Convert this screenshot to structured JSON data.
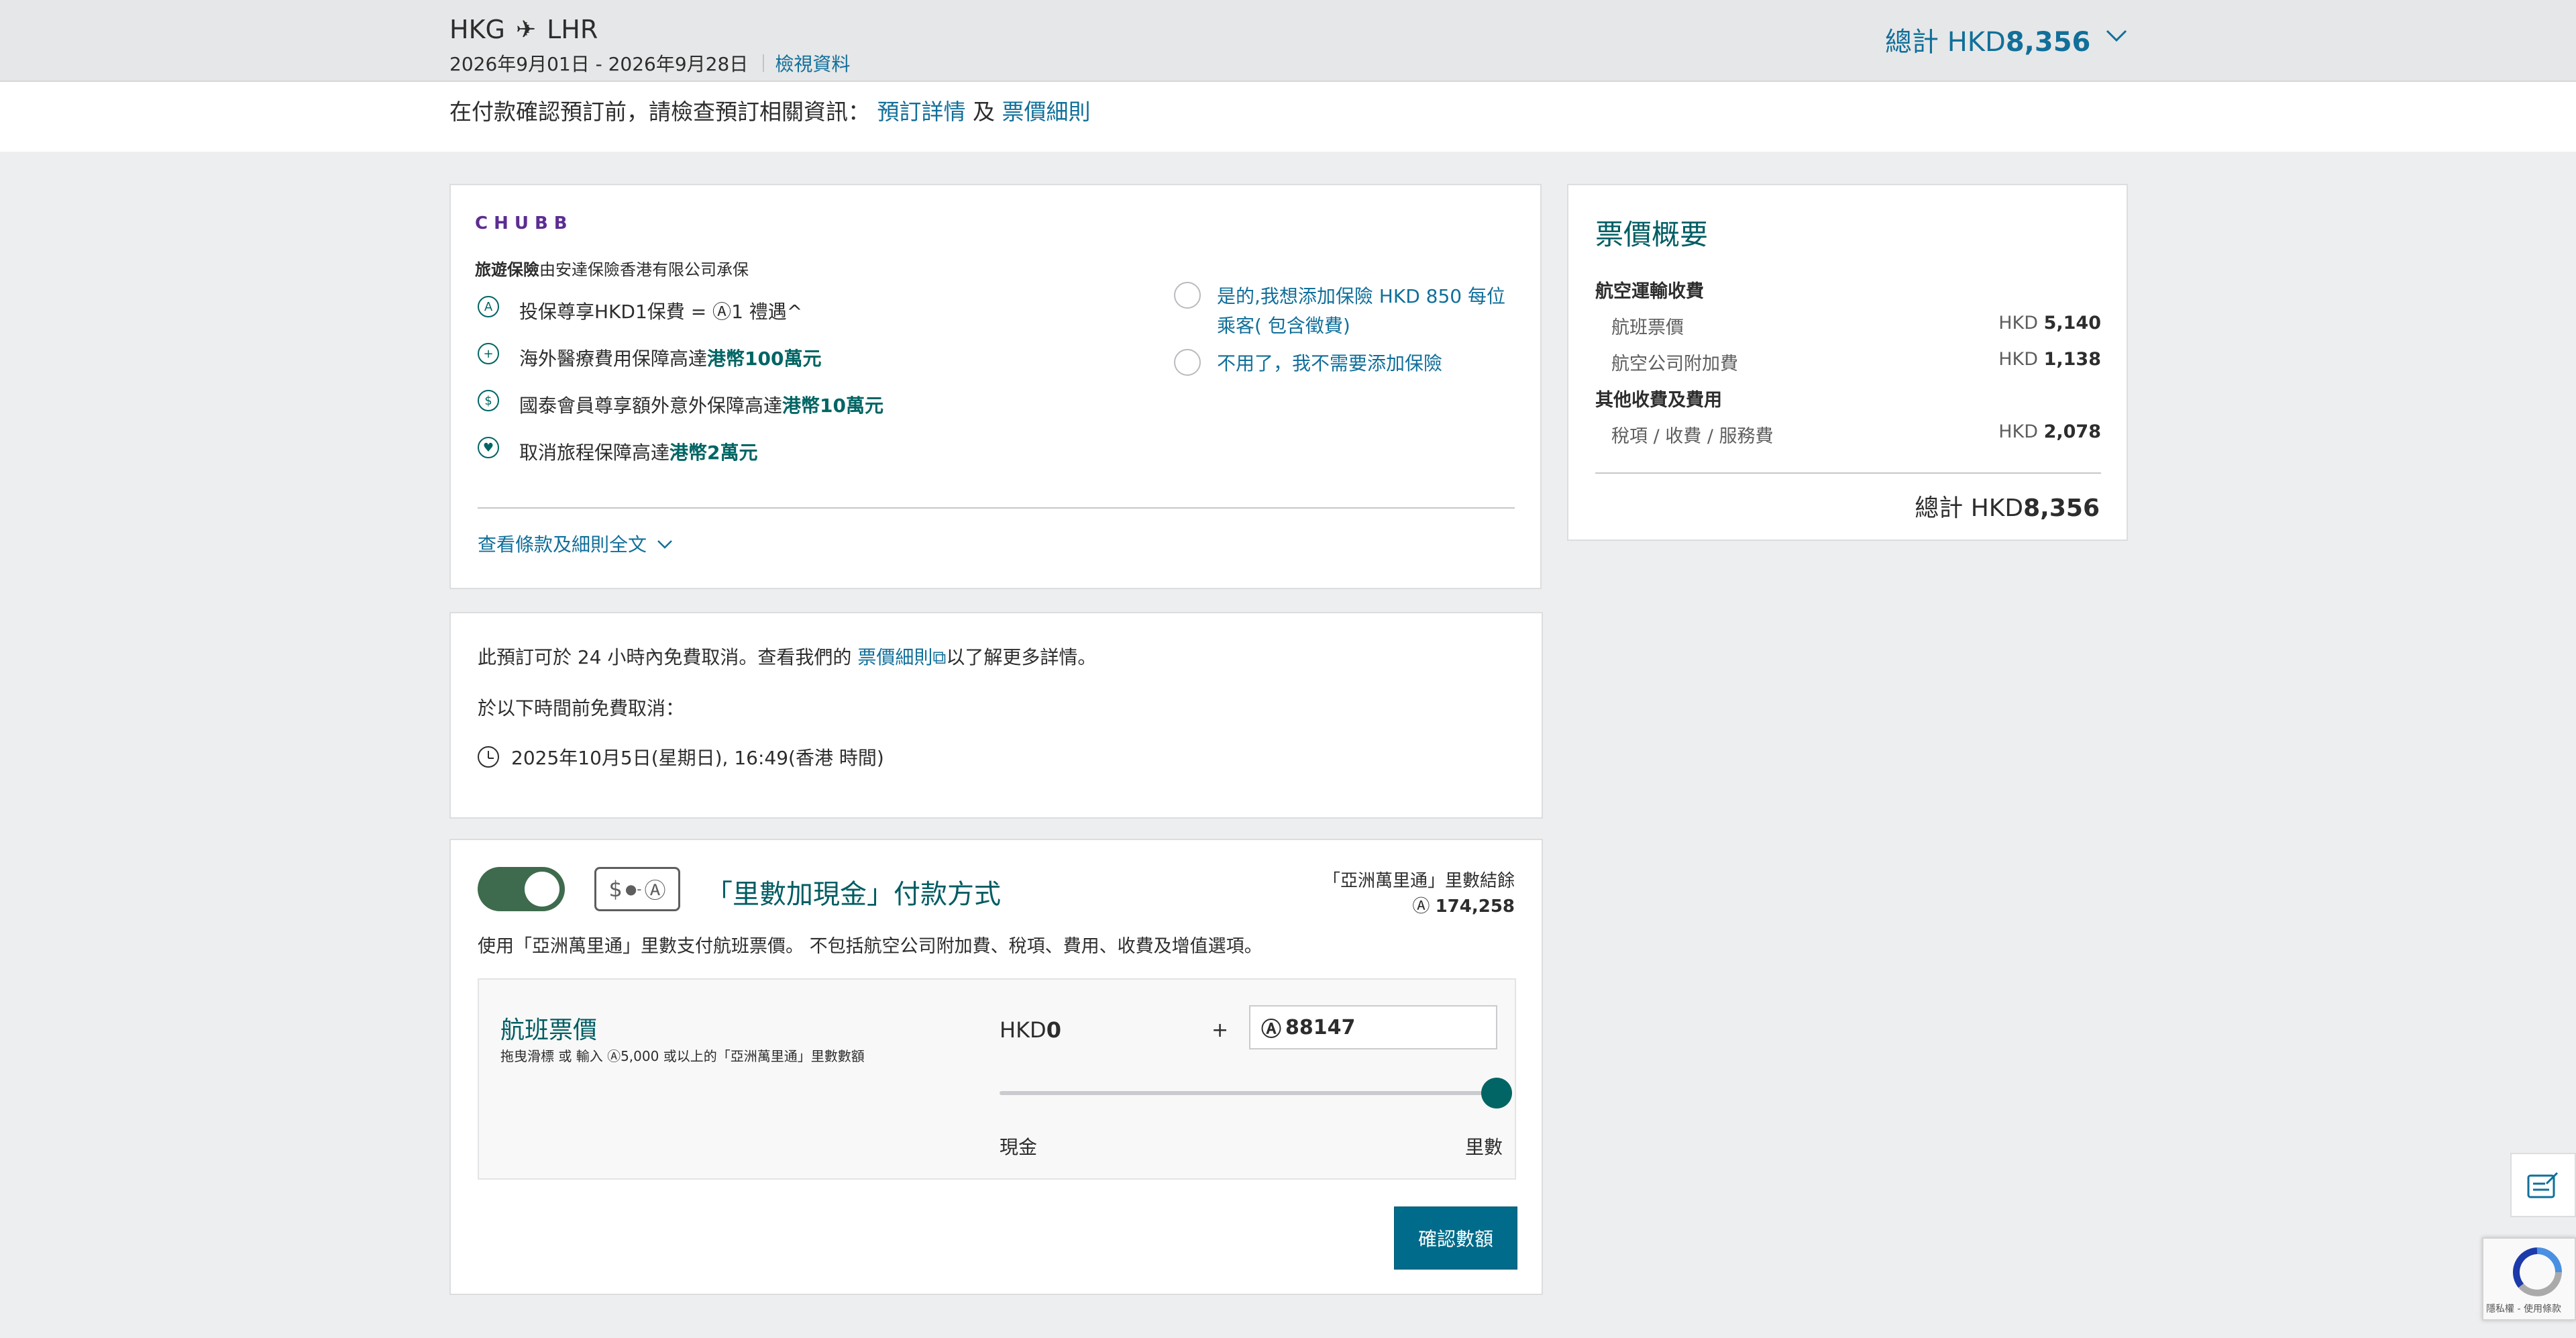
{
  "header": {
    "origin": "HKG",
    "destination": "LHR",
    "dates": "2026年9月01日 - 2026年9月28日",
    "view_details": "檢視資料",
    "total_label": "總計 HKD",
    "total_value": "8,356"
  },
  "info_strip": {
    "text": "在付款確認預訂前，請檢查預訂相關資訊：",
    "link1": "預訂詳情",
    "and": "及",
    "link2": "票價細則"
  },
  "insurance": {
    "brand": "CHUBB",
    "subtitle_bold": "旅遊保險",
    "subtitle_rest": "由安達保險香港有限公司承保",
    "items": [
      {
        "text": "投保尊享HKD1保費 = ",
        "icon": "asia-miles-icon",
        "bold": "",
        "tail": "1 禮遇^"
      },
      {
        "text": "海外醫療費用保障高達",
        "icon": "medical-icon",
        "bold": "港幣100萬元",
        "tail": ""
      },
      {
        "text": "國泰會員尊享額外意外保障高達",
        "icon": "member-icon",
        "bold": "港幣10萬元",
        "tail": ""
      },
      {
        "text": "取消旅程保障高達",
        "icon": "heart-icon",
        "bold": "港幣2萬元",
        "tail": ""
      }
    ],
    "option_yes": "是的,我想添加保險 HKD 850 每位乘客( 包含徵費)",
    "option_no": "不用了，我不需要添加保險",
    "terms_link": "查看條款及細則全文"
  },
  "cancellation": {
    "line1_pre": "此預訂可於 24 小時內免費取消。查看我們的",
    "line1_link": "票價細則",
    "line1_post": "以了解更多詳情。",
    "line2": "於以下時間前免費取消：",
    "deadline": "2025年10月5日(星期日), 16:49(香港 時間)"
  },
  "miles": {
    "title": "「里數加現金」付款方式",
    "balance_label": "「亞洲萬里通」里數結餘",
    "balance_value": "174,258",
    "description": "使用「亞洲萬里通」里數支付航班票價。 不包括航空公司附加費、稅項、費用、收費及增值選項。",
    "fare_title": "航班票價",
    "fare_hint_pre": "拖曳滑標 或 輸入 ",
    "fare_hint_post": "5,000 或以上的「亞洲萬里通」里數數額",
    "cash_prefix": "HKD",
    "cash_value": "0",
    "plus": "+",
    "miles_value": "88147",
    "slider_value": 1.0,
    "cash_label": "現金",
    "miles_label": "里數",
    "confirm": "確認數額"
  },
  "fare_summary": {
    "title": "票價概要",
    "section1": "航空運輸收費",
    "row1_label": "航班票價",
    "row1_cur": "HKD",
    "row1_val": "5,140",
    "row2_label": "航空公司附加費",
    "row2_cur": "HKD",
    "row2_val": "1,138",
    "section2": "其他收費及費用",
    "row3_label": "稅項 / 收費 / 服務費",
    "row3_cur": "HKD",
    "row3_val": "2,078",
    "total_label": "總計 HKD",
    "total_value": "8,356"
  },
  "recaptcha": {
    "text": "隱私權 - 使用條款"
  },
  "colors": {
    "accent": "#116f9a",
    "brand_teal": "#005d63",
    "button": "#006b8a",
    "toggle_on": "#3e6b4d",
    "chubb": "#5c2d91"
  }
}
